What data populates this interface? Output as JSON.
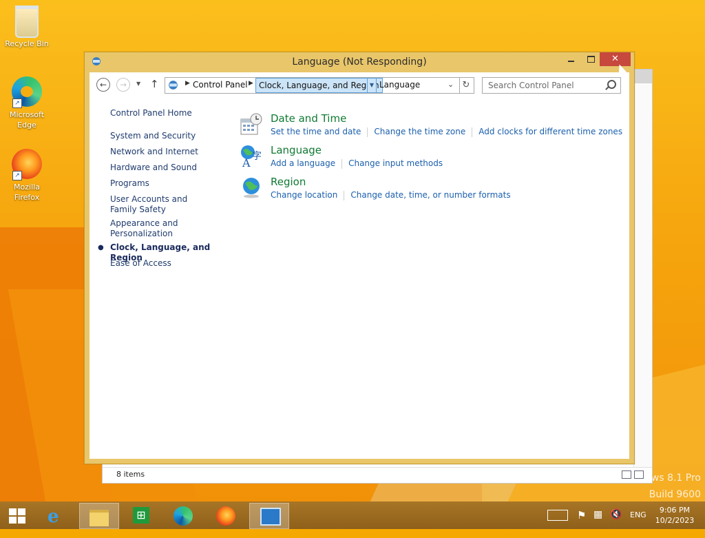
{
  "desktop": {
    "icons": [
      {
        "label": "Recycle Bin",
        "icon": "recycle-bin-icon"
      },
      {
        "label": "Microsoft Edge",
        "icon": "edge-icon"
      },
      {
        "label": "Mozilla Firefox",
        "icon": "firefox-icon"
      }
    ],
    "watermark": {
      "line1": "ws 8.1 Pro",
      "line2": "Build 9600"
    }
  },
  "back_window": {
    "status_items": "8 items",
    "help_glyph": "?"
  },
  "window": {
    "title": "Language (Not Responding)",
    "close_glyph": "✕",
    "nav": {
      "back_glyph": "←",
      "forward_glyph": "→",
      "up_glyph": "↑",
      "refresh_glyph": "↻"
    },
    "address": {
      "crumb1": "Control Panel",
      "crumb2": "Clock, Language, and Region",
      "crumb3": "Language"
    },
    "search": {
      "placeholder": "Search Control Panel"
    },
    "left_nav": {
      "home": "Control Panel Home",
      "items": [
        "System and Security",
        "Network and Internet",
        "Hardware and Sound",
        "Programs",
        "User Accounts and Family Safety",
        "Appearance and Personalization",
        "Clock, Language, and Region",
        "Ease of Access"
      ],
      "active_index": 6
    },
    "categories": [
      {
        "title": "Date and Time",
        "icon": "calendar-clock-icon",
        "links": [
          "Set the time and date",
          "Change the time zone",
          "Add clocks for different time zones"
        ]
      },
      {
        "title": "Language",
        "icon": "language-globe-icon",
        "links": [
          "Add a language",
          "Change input methods"
        ]
      },
      {
        "title": "Region",
        "icon": "region-globe-icon",
        "links": [
          "Change location",
          "Change date, time, or number formats"
        ]
      }
    ]
  },
  "taskbar": {
    "apps": [
      "Start",
      "Internet Explorer",
      "File Explorer",
      "Store",
      "Microsoft Edge",
      "Firefox",
      "Control Panel"
    ],
    "tray": {
      "language": "ENG",
      "time": "9:06 PM",
      "date": "10/2/2023"
    }
  },
  "colors": {
    "accent_title": "#e9c66a",
    "link": "#1b5fad",
    "category_title": "#0f7a32",
    "close_red": "#c7483d"
  }
}
